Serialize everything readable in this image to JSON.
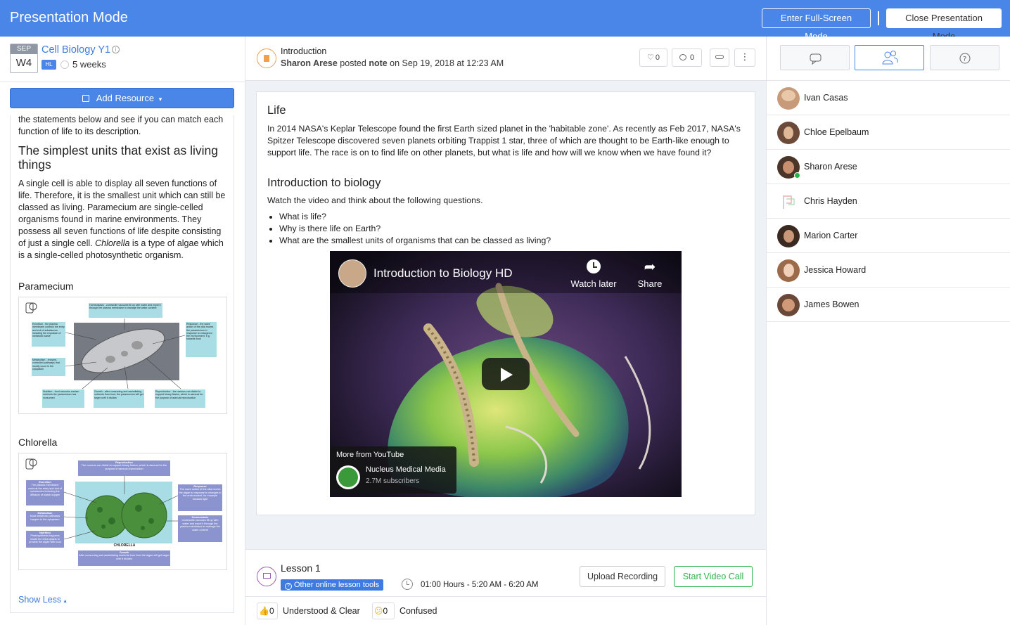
{
  "topbar": {
    "title": "Presentation Mode",
    "fullscreen_label": "Enter Full-Screen Mode",
    "close_label": "Close Presentation Mode"
  },
  "course": {
    "month": "SEP",
    "week": "W4",
    "title": "Cell Biology Y1",
    "level_badge": "HL",
    "duration": "5 weeks",
    "add_resource_label": "Add Resource"
  },
  "left_content": {
    "intro_text": "the statements below and see if you can match each function of life to its description.",
    "heading": "The simplest units that exist as living things",
    "paragraph_a": "A single cell is able to display all seven functions of life. Therefore, it is the smallest unit which can still be classed as living. Paramecium are single-celled organisms found in marine environments. They possess all seven functions of life despite consisting of just a single cell. ",
    "paragraph_italic": "Chlorella",
    "paragraph_b": " is a type of algae which is a single-celled photosynthetic organism.",
    "sub1": "Paramecium",
    "sub2": "Chlorella",
    "show_less": "Show Less",
    "diagram1": {
      "homeostasis": "Homeostasis - contractile vacuoles fill up with water and expel it through the plasma membrane to manage the water content",
      "excretion": "Excretion - the plasma membrane controls the entry and exit of substances including the expulsion of metabolic waste",
      "response": "Response - the wave action of the cilia moves the paramecium in response to changes in the environment, e.g. towards food",
      "metabolism": "Metabolism - enzyme-controlled pathways that mostly occur in the cytoplasm",
      "nutrition": "Nutrition - food vacuoles contain nutrients the paramecium has consumed",
      "growth": "Growth - after consuming and assimilating nutrients from food, the paramecium will get larger until it divides",
      "reproduction": "Reproduction - the nucleus can divide to support binary fission, which is asexual for the purpose of asexual reproduction"
    },
    "diagram2": {
      "reproduction_t": "Reproduction",
      "reproduction": "The nucleus can divide to support binary fission, which is asexual for the purpose of asexual reproduction",
      "excretion_t": "Excretion",
      "excretion": "The plasma membrane controls the entry and exit of substances including the diffusion of waste oxygen",
      "response_t": "Response",
      "response": "The wave action of the cilia moves the algae in response to changes in the environment, for example towards light",
      "metabolism_t": "Metabolism",
      "metabolism": "Most metabolic pathways happen in the cytoplasm",
      "homeostasis_t": "Homeostasis",
      "homeostasis": "Contractile vacuoles fill up with water and expel it through the plasma membrane to manage the water content",
      "nutrition_t": "Nutrition",
      "nutrition": "Photosynthesis happens inside the chloroplasts to provide the algae with food",
      "label": "CHLORELLA",
      "growth_t": "Growth",
      "growth": "After consuming and assimilating nutrients from food the algae will get larger until it divides"
    }
  },
  "post": {
    "title": "Introduction",
    "author": "Sharon Arese",
    "posted": " posted ",
    "type": "note",
    "date": " on Sep 19, 2018 at 12:23 AM",
    "likes": "0",
    "comments": "0"
  },
  "content": {
    "h1": "Life",
    "p1": "In 2014 NASA's Keplar Telescope found the first Earth sized planet in the 'habitable zone'. As recently as Feb 2017, NASA's Spitzer Telescope discovered seven planets orbiting Trappist 1 star, three of which are thought to be Earth-like enough to support life. The race is on to find life on other planets, but what is life and how will we know when we have found it?",
    "h2": "Introduction to biology",
    "p2": "Watch the video and think about the following questions.",
    "questions": [
      "What is life?",
      "Why is there life on Earth?",
      "What are the smallest units of organisms that can be classed as living?"
    ]
  },
  "video": {
    "title": "Introduction to Biology HD",
    "watch_later": "Watch later",
    "share": "Share",
    "more_from": "More from YouTube",
    "channel": "Nucleus Medical Media",
    "subscribers": "2.7M subscribers"
  },
  "lesson": {
    "title": "Lesson 1",
    "tools_label": "Other online lesson tools",
    "time": "01:00 Hours - 5:20 AM - 6:20 AM",
    "upload_label": "Upload Recording",
    "video_call_label": "Start Video Call"
  },
  "reactions": {
    "understood_count": "0",
    "understood_label": "Understood & Clear",
    "confused_count": "0",
    "confused_label": "Confused"
  },
  "people": [
    "Ivan Casas",
    "Chloe Epelbaum",
    "Sharon Arese",
    "Chris Hayden",
    "Marion Carter",
    "Jessica Howard",
    "James Bowen"
  ],
  "colors": {
    "accent": "#4a85e8",
    "green": "#2bb24c",
    "orange": "#f0a04b",
    "purple": "#9b59b6"
  }
}
